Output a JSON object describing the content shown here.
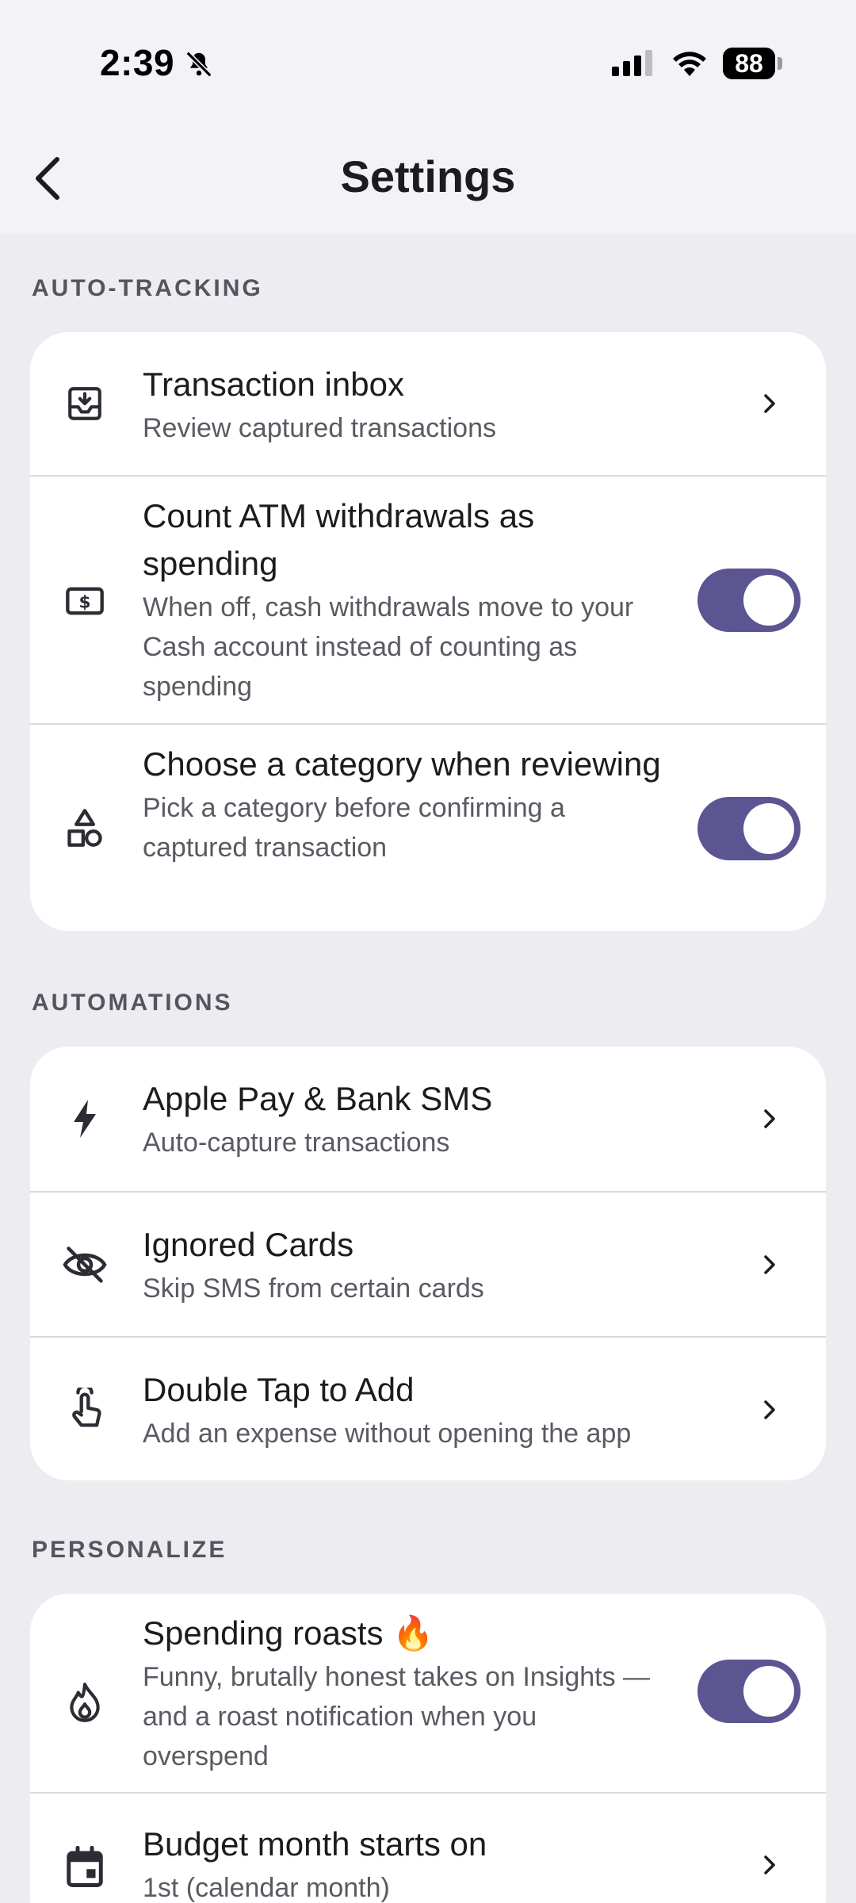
{
  "status_bar": {
    "time": "2:39",
    "battery": "88"
  },
  "nav": {
    "title": "Settings"
  },
  "sections": [
    {
      "header": "AUTO-TRACKING",
      "rows": [
        {
          "title": "Transaction inbox",
          "subtitle": "Review captured transactions",
          "icon": "inbox-download-icon",
          "control": "chevron"
        },
        {
          "title": "Count ATM withdrawals as spending",
          "subtitle": "When off, cash withdrawals move to your Cash account instead of counting as spending",
          "icon": "cash-icon",
          "control": "toggle",
          "toggle_on": true
        },
        {
          "title": "Choose a category when reviewing",
          "subtitle": "Pick a category before confirming a captured transaction",
          "icon": "shapes-icon",
          "control": "toggle",
          "toggle_on": true
        }
      ]
    },
    {
      "header": "AUTOMATIONS",
      "rows": [
        {
          "title": "Apple Pay & Bank SMS",
          "subtitle": "Auto-capture transactions",
          "icon": "lightning-icon",
          "control": "chevron"
        },
        {
          "title": "Ignored Cards",
          "subtitle": "Skip SMS from certain cards",
          "icon": "eye-off-icon",
          "control": "chevron"
        },
        {
          "title": "Double Tap to Add",
          "subtitle": "Add an expense without opening the app",
          "icon": "tap-hand-icon",
          "control": "chevron"
        }
      ]
    },
    {
      "header": "PERSONALIZE",
      "rows": [
        {
          "title": "Spending roasts 🔥",
          "subtitle": "Funny, brutally honest takes on Insights — and a roast notification when you overspend",
          "icon": "flame-icon",
          "control": "toggle",
          "toggle_on": true
        },
        {
          "title": "Budget month starts on",
          "subtitle": "1st (calendar month)",
          "icon": "calendar-icon",
          "control": "chevron"
        }
      ]
    }
  ],
  "colors": {
    "accent": "#5b5592",
    "background": "#ececf1",
    "card": "#ffffff"
  }
}
